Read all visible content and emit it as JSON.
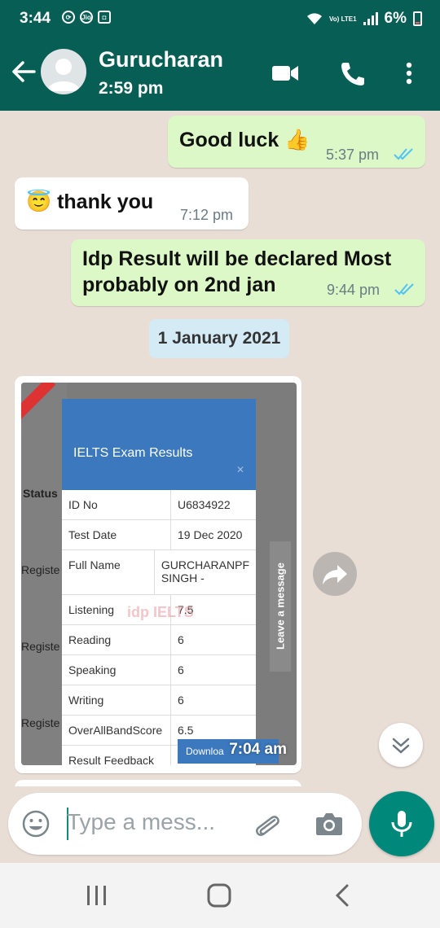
{
  "status_bar": {
    "time": "3:44",
    "battery": "6%",
    "network_label": "Vo) LTE1"
  },
  "header": {
    "contact_name": "Gurucharan",
    "last_seen": "2:59 pm"
  },
  "messages": [
    {
      "direction": "out",
      "text": "Good luck 👍",
      "time": "5:37 pm",
      "read": true
    },
    {
      "direction": "in",
      "text": "😇 thank you",
      "time": "7:12 pm"
    },
    {
      "direction": "out",
      "text_line1": "Idp Result will be declared Most",
      "text_line2": "probably on 2nd jan",
      "time": "9:44 pm",
      "read": true
    }
  ],
  "date_divider": "1 January 2021",
  "image_message": {
    "time": "7:04 am",
    "screenshot": {
      "title": "IELTS Exam Results",
      "rows": [
        {
          "key": "ID No",
          "value": "U6834922"
        },
        {
          "key": "Test Date",
          "value": "19 Dec 2020"
        },
        {
          "key": "Full Name",
          "value": "GURCHARANPF SINGH -"
        },
        {
          "key": "Listening",
          "value": "7.5"
        },
        {
          "key": "Reading",
          "value": "6"
        },
        {
          "key": "Speaking",
          "value": "6"
        },
        {
          "key": "Writing",
          "value": "6"
        },
        {
          "key": "OverAllBandScore",
          "value": "6.5"
        },
        {
          "key": "Result Feedback",
          "value": ""
        }
      ],
      "background_status_header": "Status",
      "background_rows": [
        "Registe",
        "Registe",
        "Registe"
      ],
      "leave_message": "Leave a message",
      "download_label": "Downloa",
      "watermark": "idp IELTS"
    }
  },
  "input": {
    "placeholder": "Type a mess..."
  },
  "colors": {
    "header": "#075e54",
    "outgoing_bubble": "#dcf8c6",
    "incoming_bubble": "#ffffff",
    "accent": "#00897b",
    "read_ticks": "#4fc3f7"
  }
}
